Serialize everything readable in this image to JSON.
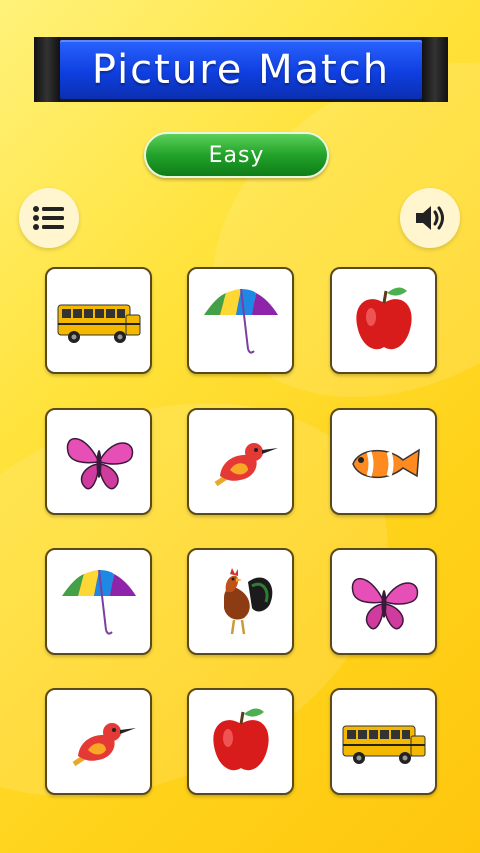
{
  "header": {
    "title": "Picture Match"
  },
  "level": {
    "label": "Easy"
  },
  "toolbar": {
    "menu_icon": "menu-list-icon",
    "sound_icon": "speaker-icon"
  },
  "colors": {
    "banner": "#1746f0",
    "level_button": "#22a22a",
    "background": "#ffd81f",
    "card_border": "#5a4a1a"
  },
  "cards": [
    {
      "item": "school-bus"
    },
    {
      "item": "umbrella"
    },
    {
      "item": "apple"
    },
    {
      "item": "butterfly"
    },
    {
      "item": "bird"
    },
    {
      "item": "fish"
    },
    {
      "item": "umbrella"
    },
    {
      "item": "rooster"
    },
    {
      "item": "butterfly"
    },
    {
      "item": "bird"
    },
    {
      "item": "apple"
    },
    {
      "item": "school-bus"
    }
  ]
}
